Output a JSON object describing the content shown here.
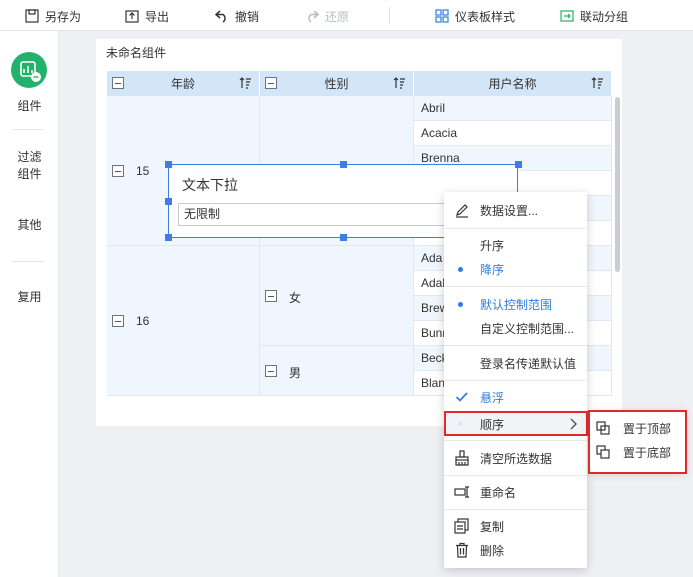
{
  "toolbar": {
    "save_as": "另存为",
    "export": "导出",
    "undo": "撤销",
    "redo": "还原",
    "dashboard_style": "仪表板样式",
    "link_group": "联动分组"
  },
  "sidebar": {
    "items": [
      {
        "label": "组件"
      },
      {
        "label": "过滤\n组件"
      },
      {
        "label": "其他"
      },
      {
        "label": "复用"
      }
    ],
    "accent": "#23b26d"
  },
  "widget": {
    "title": "未命名组件",
    "columns": [
      {
        "label": "年龄"
      },
      {
        "label": "性别"
      },
      {
        "label": "用户名称"
      }
    ],
    "age_groups": [
      {
        "value": "15"
      },
      {
        "value": "16"
      }
    ],
    "gender_groups": [
      {
        "value": "女"
      },
      {
        "value": "男"
      }
    ],
    "names": [
      "Abril",
      "Acacia",
      "Brenna",
      "Ada",
      "Adah",
      "Brew",
      "Bunn",
      "Beck",
      "Blanc"
    ]
  },
  "filter_widget": {
    "title": "文本下拉",
    "value": "无限制"
  },
  "context_menu": {
    "items": [
      {
        "label": "数据设置..."
      },
      {
        "label": "升序"
      },
      {
        "label": "降序"
      },
      {
        "label": "默认控制范围"
      },
      {
        "label": "自定义控制范围..."
      },
      {
        "label": "登录名传递默认值"
      },
      {
        "label": "悬浮"
      },
      {
        "label": "顺序"
      },
      {
        "label": "清空所选数据"
      },
      {
        "label": "重命名"
      },
      {
        "label": "复制"
      },
      {
        "label": "删除"
      }
    ],
    "accent": "#2f7de1"
  },
  "submenu": {
    "items": [
      {
        "label": "置于顶部"
      },
      {
        "label": "置于底部"
      }
    ]
  },
  "highlight_color": "#e02a2a"
}
